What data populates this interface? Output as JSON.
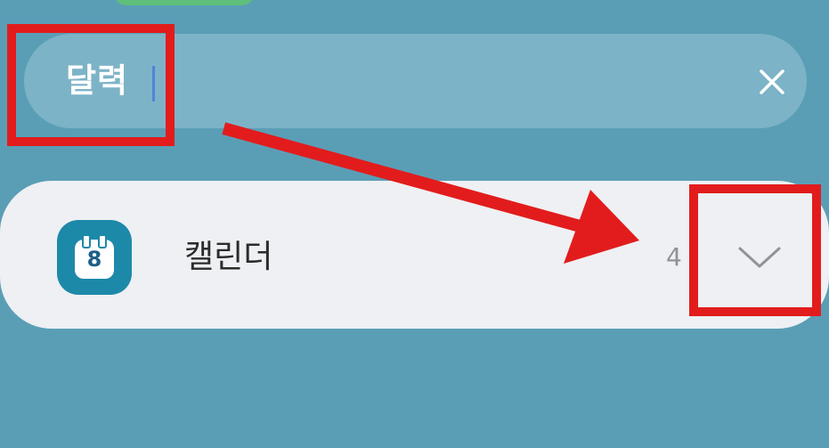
{
  "search": {
    "query": "달력"
  },
  "result": {
    "app_name": "캘린더",
    "icon_day": "8",
    "count": "4"
  },
  "icons": {
    "clear": "close-icon",
    "expand": "chevron-down-icon",
    "app": "calendar-app-icon"
  },
  "colors": {
    "background": "#5a9eb6",
    "search_bar": "#7db3c7",
    "card": "#eef0f3",
    "app_icon": "#1d89a8",
    "annotation": "#e21c1c"
  }
}
